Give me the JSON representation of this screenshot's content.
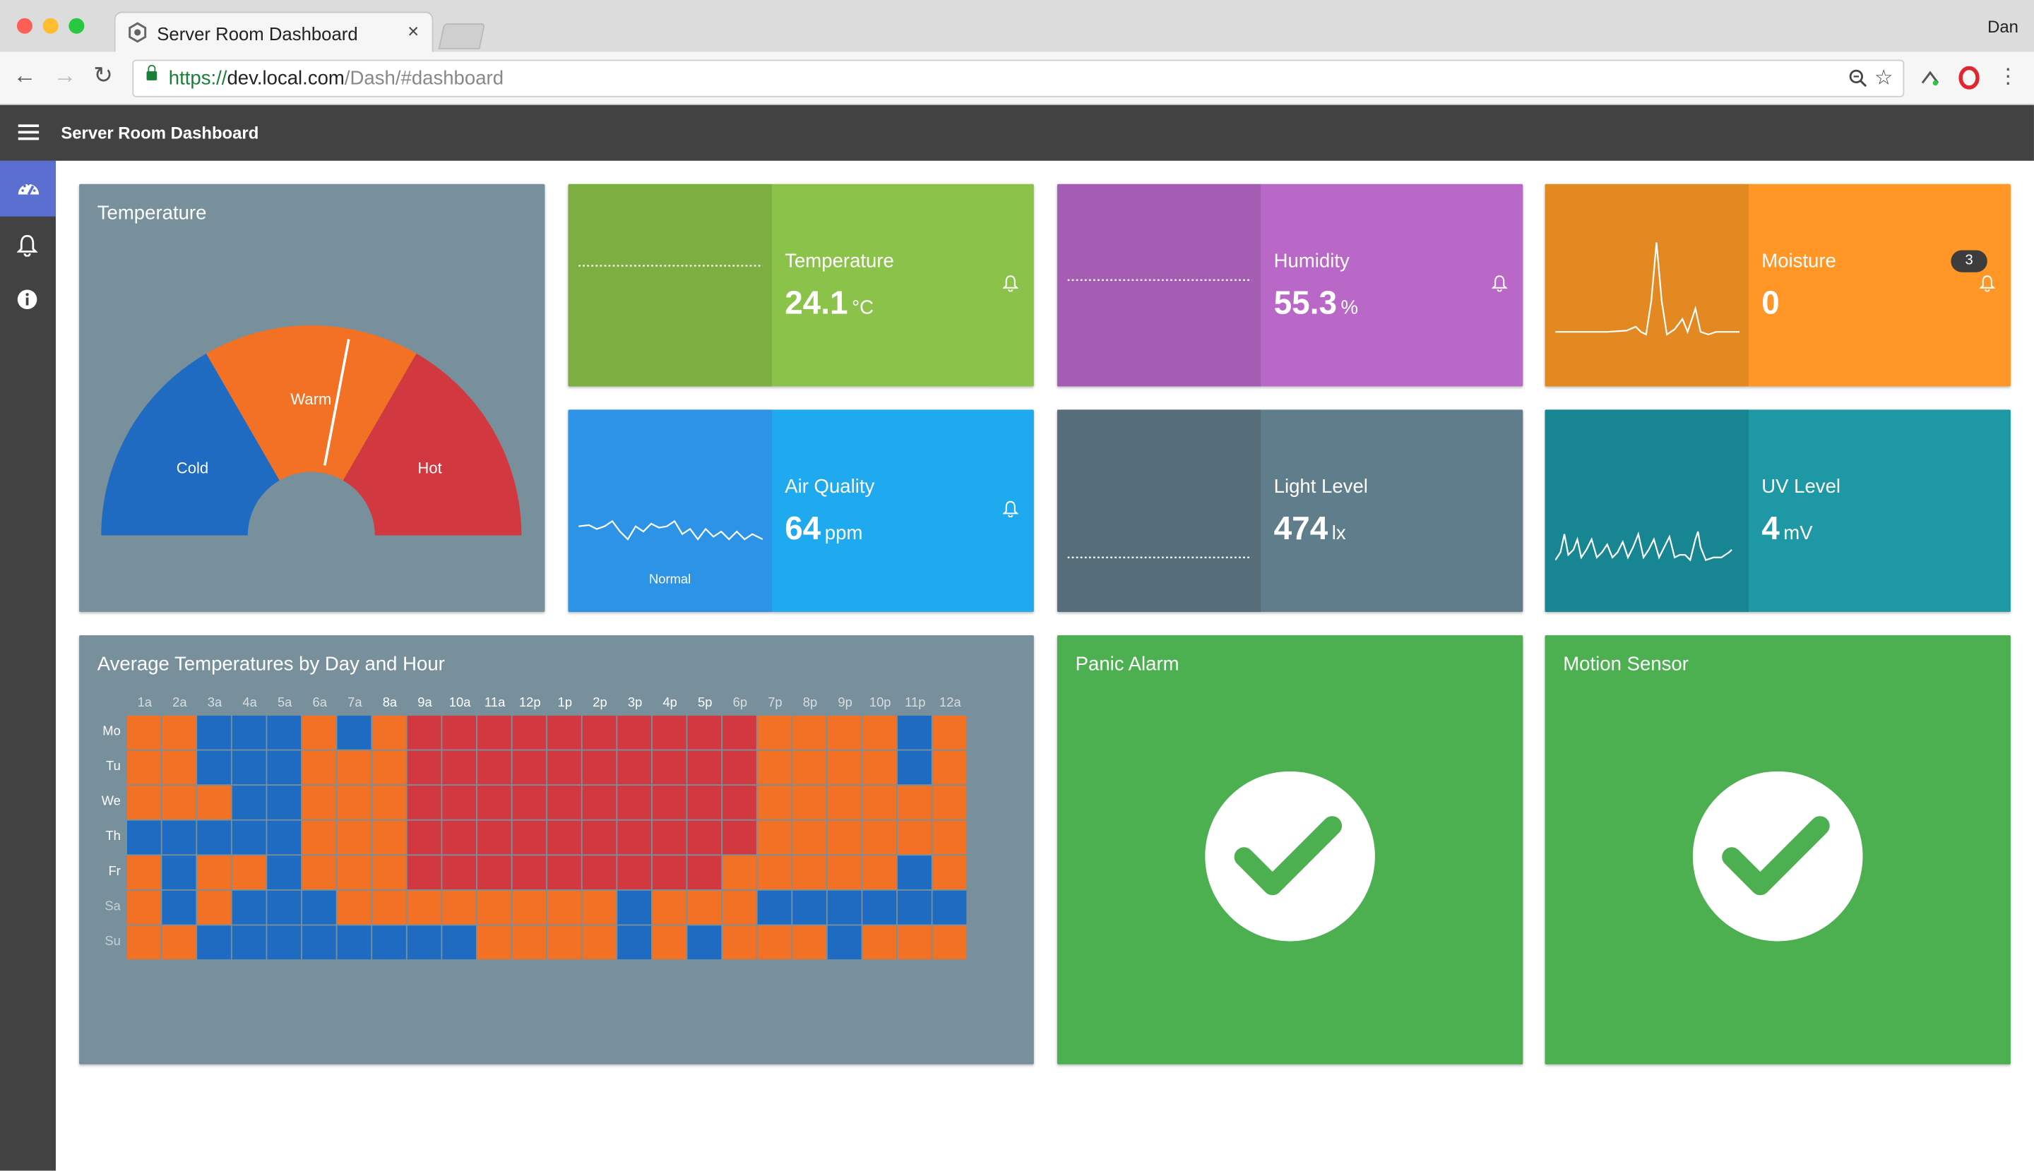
{
  "browser": {
    "tab_title": "Server Room Dashboard",
    "tab_close": "×",
    "profile_name": "Dan",
    "url": {
      "scheme": "https://",
      "host": "dev.local.com",
      "path": "/Dash/#dashboard"
    }
  },
  "app": {
    "title": "Server Room Dashboard",
    "sidebar": [
      {
        "icon": "dashboard-icon",
        "active": true
      },
      {
        "icon": "bell-icon",
        "active": false
      },
      {
        "icon": "info-icon",
        "active": false
      }
    ]
  },
  "gauge": {
    "title": "Temperature",
    "segments": [
      "Cold",
      "Warm",
      "Hot"
    ],
    "colors": {
      "cold": "#1e6bc1",
      "warm": "#f37124",
      "hot": "#d1383f"
    },
    "needle_fraction": 0.56
  },
  "tiles": {
    "temperature": {
      "label": "Temperature",
      "value": "24.1",
      "unit": "°C",
      "color": "#8bc34a",
      "left_color": "#7cae42"
    },
    "humidity": {
      "label": "Humidity",
      "value": "55.3",
      "unit": "%",
      "color": "#ba68c8",
      "left_color": "#a55cb3"
    },
    "moisture": {
      "label": "Moisture",
      "value": "0",
      "unit": "",
      "badge": "3",
      "color": "#ff9626",
      "left_color": "#e48822"
    },
    "air_quality": {
      "label": "Air Quality",
      "value": "64",
      "unit": "ppm",
      "caption": "Normal",
      "color": "#1fa9ef",
      "left_color": "#2c93e6"
    },
    "light_level": {
      "label": "Light Level",
      "value": "474",
      "unit": "lx",
      "color": "#607d8b",
      "left_color": "#566e7a"
    },
    "uv_level": {
      "label": "UV Level",
      "value": "4",
      "unit": "mV",
      "color": "#1f98a6",
      "left_color": "#178692"
    }
  },
  "heatmap": {
    "title": "Average Temperatures by Day and Hour",
    "hours": [
      "1a",
      "2a",
      "3a",
      "4a",
      "5a",
      "6a",
      "7a",
      "8a",
      "9a",
      "10a",
      "11a",
      "12p",
      "1p",
      "2p",
      "3p",
      "4p",
      "5p",
      "6p",
      "7p",
      "8p",
      "9p",
      "10p",
      "11p",
      "12a"
    ],
    "days": [
      "Mo",
      "Tu",
      "We",
      "Th",
      "Fr",
      "Sa",
      "Su"
    ],
    "legend": {
      "0": "#1e6bc1",
      "1": "#f37124",
      "2": "#d1383f"
    },
    "values": [
      [
        1,
        1,
        0,
        0,
        0,
        1,
        0,
        1,
        2,
        2,
        2,
        2,
        2,
        2,
        2,
        2,
        2,
        2,
        1,
        1,
        1,
        1,
        0,
        1
      ],
      [
        1,
        1,
        0,
        0,
        0,
        1,
        1,
        1,
        2,
        2,
        2,
        2,
        2,
        2,
        2,
        2,
        2,
        2,
        1,
        1,
        1,
        1,
        0,
        1
      ],
      [
        1,
        1,
        1,
        0,
        0,
        1,
        1,
        1,
        2,
        2,
        2,
        2,
        2,
        2,
        2,
        2,
        2,
        2,
        1,
        1,
        1,
        1,
        1,
        1
      ],
      [
        0,
        0,
        0,
        0,
        0,
        1,
        1,
        1,
        2,
        2,
        2,
        2,
        2,
        2,
        2,
        2,
        2,
        2,
        1,
        1,
        1,
        1,
        1,
        1
      ],
      [
        1,
        0,
        1,
        1,
        0,
        1,
        1,
        1,
        2,
        2,
        2,
        2,
        2,
        2,
        2,
        2,
        2,
        1,
        1,
        1,
        1,
        1,
        0,
        1
      ],
      [
        1,
        0,
        1,
        0,
        0,
        0,
        1,
        1,
        1,
        1,
        1,
        1,
        1,
        1,
        0,
        1,
        1,
        1,
        0,
        0,
        0,
        0,
        0,
        0
      ],
      [
        1,
        1,
        0,
        0,
        0,
        0,
        0,
        0,
        0,
        0,
        1,
        1,
        1,
        1,
        0,
        1,
        0,
        1,
        1,
        1,
        0,
        1,
        1,
        1
      ]
    ]
  },
  "alarms": {
    "panic": {
      "title": "Panic Alarm",
      "status": "ok",
      "color": "#4caf50"
    },
    "motion": {
      "title": "Motion Sensor",
      "status": "ok",
      "color": "#4caf50"
    }
  }
}
